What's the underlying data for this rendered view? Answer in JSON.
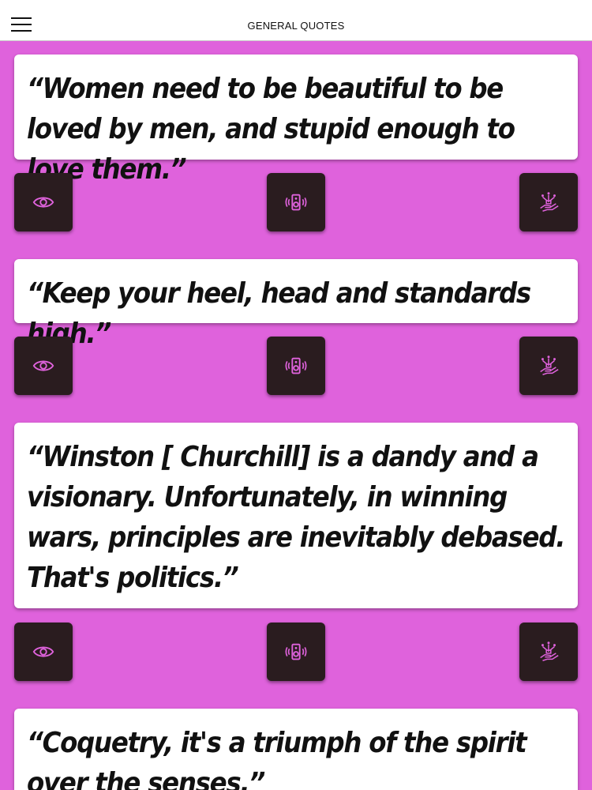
{
  "header": {
    "title": "GENERAL QUOTES",
    "menu_icon": "hamburger-menu-icon"
  },
  "quotes": [
    {
      "text": "“Women need to be beautiful to be loved by men, and stupid enough to love them.”"
    },
    {
      "text": "“Keep your heel, head and standards high.”"
    },
    {
      "text": "“Winston [ Churchill] is a dandy and a visionary. Unfortunately, in winning wars, principles are inevitably debased. That's politics.”"
    },
    {
      "text": "“Coquetry, it's a triumph of the spirit over the senses.”"
    }
  ],
  "actions": {
    "view_icon": "eye-icon",
    "speak_icon": "speaker-icon",
    "share_icon": "hand-share-icon"
  },
  "colors": {
    "background": "#df62dc",
    "card": "#ffffff",
    "action_button": "#2a1c1f",
    "icon_accent": "#df62dc"
  }
}
